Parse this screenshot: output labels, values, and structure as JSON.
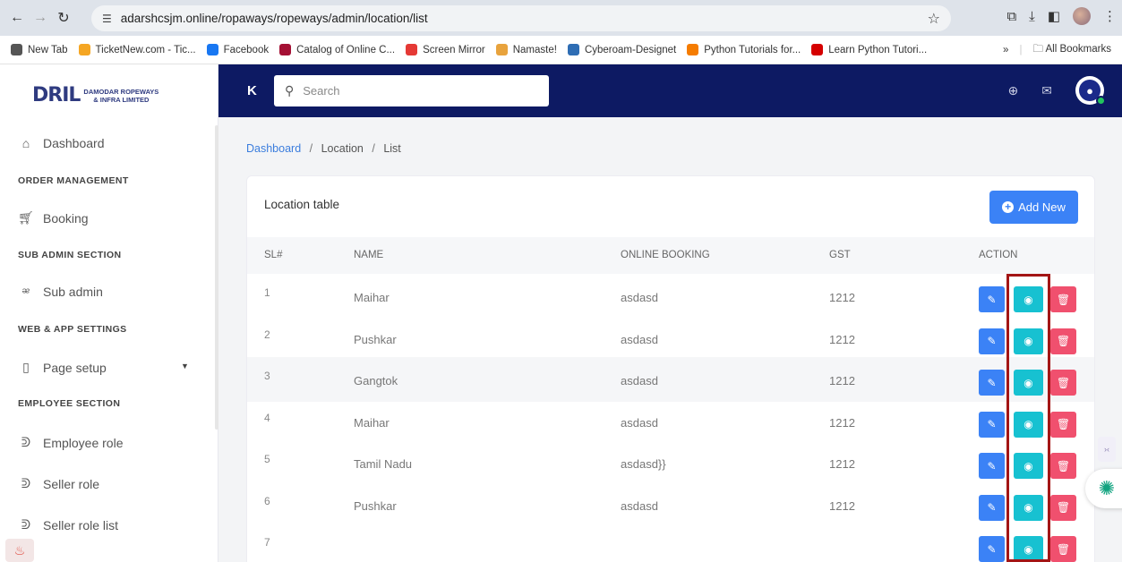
{
  "browser": {
    "url": "adarshcsjm.online/ropaways/ropeways/admin/location/list",
    "bookmarks": [
      {
        "label": "New Tab",
        "color": "#555555"
      },
      {
        "label": "TicketNew.com - Tic...",
        "color": "#f5a623"
      },
      {
        "label": "Facebook",
        "color": "#1877f2"
      },
      {
        "label": "Catalog of Online C...",
        "color": "#a41034"
      },
      {
        "label": "Screen Mirror",
        "color": "#e53935"
      },
      {
        "label": "Namaste!",
        "color": "#e8a33d"
      },
      {
        "label": "Cyberoam-Designet",
        "color": "#2e6db4"
      },
      {
        "label": "Python Tutorials for...",
        "color": "#f57c00"
      },
      {
        "label": "Learn Python Tutori...",
        "color": "#d50000"
      }
    ],
    "bookmarks_more": "»",
    "all_bookmarks": "All Bookmarks"
  },
  "sidebar": {
    "logo_mark": "DRIL",
    "logo_line1": "DAMODAR ROPEWAYS",
    "logo_line2": "& INFRA LIMITED",
    "dashboard": "Dashboard",
    "section_order": "ORDER MANAGEMENT",
    "booking": "Booking",
    "section_subadmin": "SUB ADMIN SECTION",
    "subadmin": "Sub admin",
    "section_web": "WEB & APP SETTINGS",
    "pagesetup": "Page setup",
    "section_employee": "EMPLOYEE SECTION",
    "employee_role": "Employee role",
    "seller_role": "Seller role",
    "seller_role_list": "Seller role list"
  },
  "topbar": {
    "search_placeholder": "Search"
  },
  "breadcrumb": {
    "home": "Dashboard",
    "sep": "/",
    "section": "Location",
    "current": "List"
  },
  "card": {
    "title": "Location table",
    "add_label": "Add New"
  },
  "table": {
    "headers": {
      "sl": "SL#",
      "name": "NAME",
      "online": "ONLINE BOOKING",
      "gst": "GST",
      "action": "ACTION"
    },
    "rows": [
      {
        "sl": "1",
        "name": "Maihar",
        "online": "asdasd",
        "gst": "1212"
      },
      {
        "sl": "2",
        "name": "Pushkar",
        "online": "asdasd",
        "gst": "1212"
      },
      {
        "sl": "3",
        "name": "Gangtok",
        "online": "asdasd",
        "gst": "1212"
      },
      {
        "sl": "4",
        "name": "Maihar",
        "online": "asdasd",
        "gst": "1212"
      },
      {
        "sl": "5",
        "name": "Tamil Nadu",
        "online": "asdasd}}",
        "gst": "1212"
      },
      {
        "sl": "6",
        "name": "Pushkar",
        "online": "asdasd",
        "gst": "1212"
      },
      {
        "sl": "7",
        "name": "",
        "online": "",
        "gst": ""
      }
    ]
  },
  "colors": {
    "topbar": "#0d1a63",
    "edit": "#3b82f6",
    "view": "#17c1d1",
    "delete": "#f0506e",
    "highlight": "#a31515"
  }
}
